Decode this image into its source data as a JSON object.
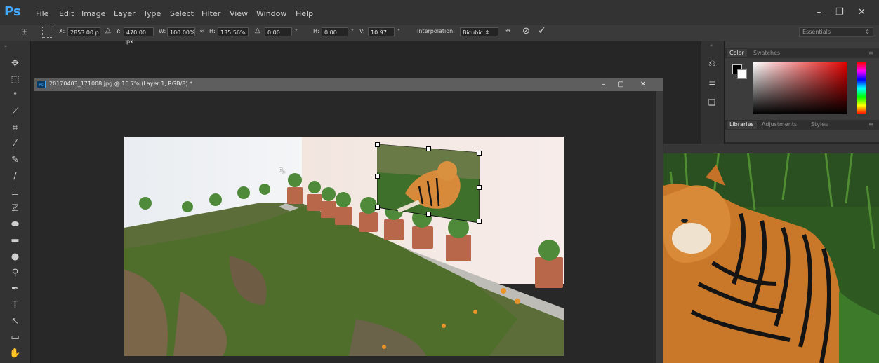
{
  "app": {
    "logo": "Ps"
  },
  "menu": [
    "File",
    "Edit",
    "Image",
    "Layer",
    "Type",
    "Select",
    "Filter",
    "View",
    "Window",
    "Help"
  ],
  "window_controls": [
    "–",
    "❐",
    "✕"
  ],
  "options_bar": {
    "x_label": "X:",
    "x_value": "2853.00 p",
    "y_label": "Y:",
    "y_value": "470.00 px",
    "w_label": "W:",
    "w_value": "100.00%",
    "link_glyph": "∞",
    "h_label": "H:",
    "h_value": "135.56%",
    "angle_glyph": "△",
    "angle_value": "0.00",
    "deg1": "°",
    "hskew_label": "H:",
    "hskew_value": "0.00",
    "deg2": "°",
    "vskew_label": "V:",
    "vskew_value": "10.97",
    "deg3": "°",
    "interp_label": "Interpolation:",
    "interp_value": "Bicubic",
    "warp_icon": "warp-icon",
    "cancel_icon": "cancel-icon",
    "commit_icon": "check-icon",
    "workspace": "Essentials"
  },
  "tools": [
    "move",
    "marquee",
    "lasso",
    "quick-select",
    "crop",
    "eyedropper",
    "healing",
    "brush",
    "clone-stamp",
    "history-brush",
    "eraser",
    "gradient",
    "blur",
    "dodge",
    "pen",
    "type",
    "path-select",
    "rectangle",
    "hand",
    "zoom"
  ],
  "document": {
    "title": "20170403_171008.jpg @ 16.7% (Layer 1, RGB/8) *",
    "controls": [
      "–",
      "▢",
      "✕"
    ]
  },
  "panels": {
    "color_tabs": [
      "Color",
      "Swatches"
    ],
    "lib_tabs": [
      "Libraries",
      "Adjustments",
      "Styles"
    ]
  },
  "colors": {
    "accent": "#41a8ff",
    "panel": "#3c3c3c",
    "menubar": "#333333"
  }
}
